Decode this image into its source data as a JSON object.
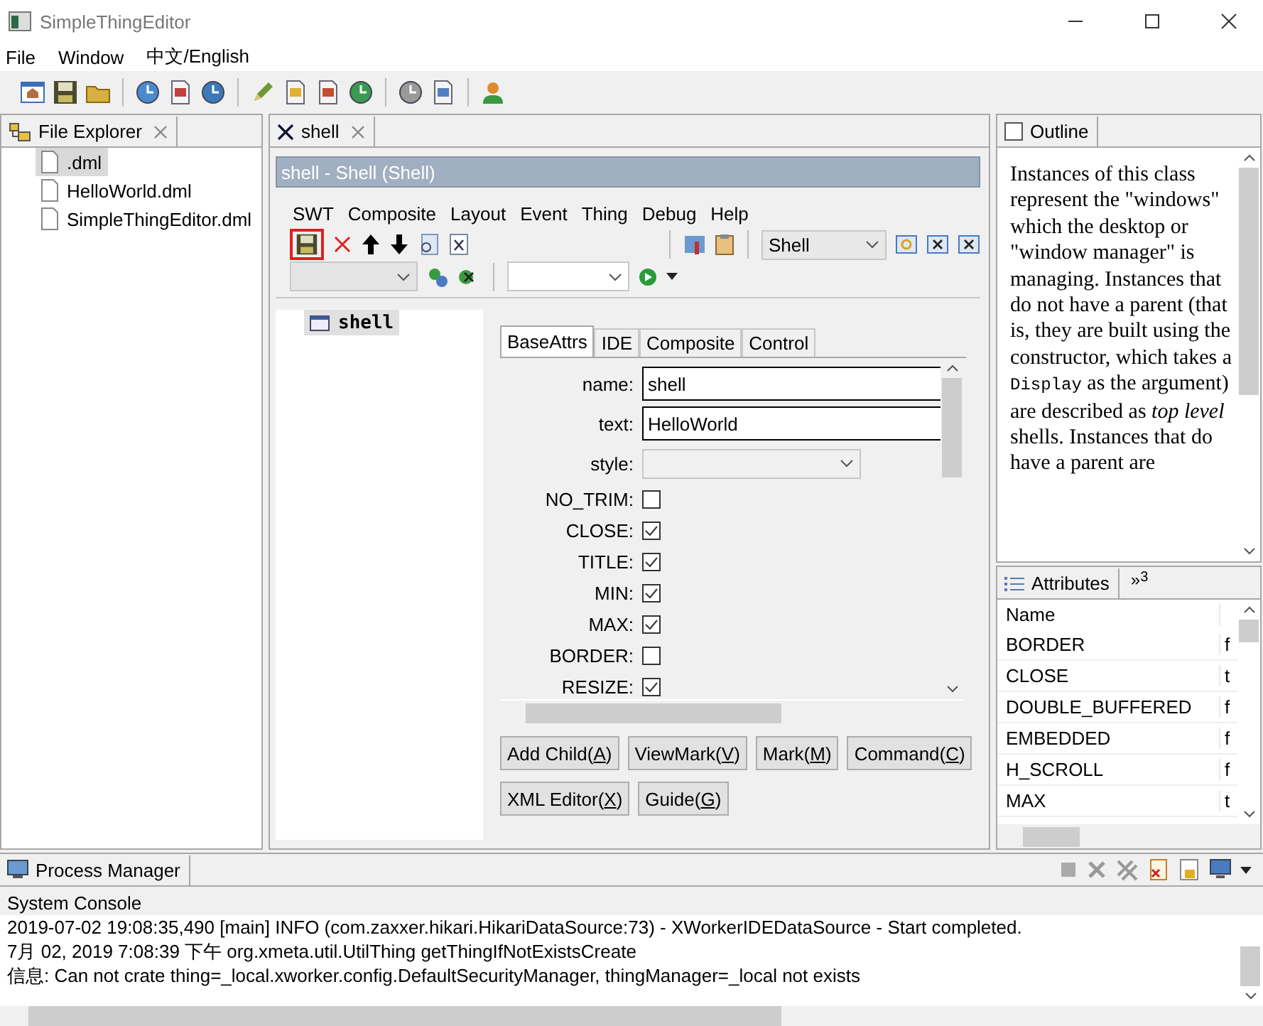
{
  "window": {
    "title": "SimpleThingEditor"
  },
  "menu": [
    "File",
    "Window",
    "中文/English"
  ],
  "file_explorer": {
    "tab": "File Explorer",
    "files": [
      {
        "name": ".dml",
        "selected": true
      },
      {
        "name": "HelloWorld.dml",
        "selected": false
      },
      {
        "name": "SimpleThingEditor.dml",
        "selected": false
      }
    ]
  },
  "editor": {
    "tab": "shell",
    "header": "shell - Shell  (Shell)",
    "menu": [
      "SWT",
      "Composite",
      "Layout",
      "Event",
      "Thing",
      "Debug",
      "Help"
    ],
    "save_focused": true,
    "type_select": "Shell",
    "tree": [
      {
        "label": "shell",
        "selected": true
      }
    ],
    "prop_tabs": [
      {
        "label": "BaseAttrs",
        "selected": true
      },
      {
        "label": "IDE",
        "selected": false
      },
      {
        "label": "Composite",
        "selected": false
      },
      {
        "label": "Control",
        "selected": false
      }
    ],
    "fields": [
      {
        "kind": "text",
        "label": "name:",
        "value": "shell"
      },
      {
        "kind": "text",
        "label": "text:",
        "value": "HelloWorld"
      },
      {
        "kind": "select",
        "label": "style:"
      },
      {
        "kind": "checkbox",
        "label": "NO_TRIM:",
        "checked": false
      },
      {
        "kind": "checkbox",
        "label": "CLOSE:",
        "checked": true
      },
      {
        "kind": "checkbox",
        "label": "TITLE:",
        "checked": true
      },
      {
        "kind": "checkbox",
        "label": "MIN:",
        "checked": true
      },
      {
        "kind": "checkbox",
        "label": "MAX:",
        "checked": true
      },
      {
        "kind": "checkbox",
        "label": "BORDER:",
        "checked": false
      },
      {
        "kind": "checkbox",
        "label": "RESIZE:",
        "checked": true
      }
    ],
    "button_rows": [
      [
        {
          "label": "Add Child(",
          "mnemonic": "A",
          "suffix": ")"
        },
        {
          "label": "ViewMark(",
          "mnemonic": "V",
          "suffix": ")"
        },
        {
          "label": "Mark(",
          "mnemonic": "M",
          "suffix": ")"
        },
        {
          "label": "Command(",
          "mnemonic": "C",
          "suffix": ")"
        }
      ],
      [
        {
          "label": "XML Editor(",
          "mnemonic": "X",
          "suffix": ")"
        },
        {
          "label": "Guide(",
          "mnemonic": "G",
          "suffix": ")"
        }
      ]
    ]
  },
  "outline": {
    "tab": "Outline",
    "segments": [
      {
        "kind": "plain",
        "text": "Instances of this class represent the \"windows\" which the desktop or \"window manager\" is managing. Instances that do not have a parent (that is, they are built using the constructor, which takes a "
      },
      {
        "kind": "code",
        "text": "Display"
      },
      {
        "kind": "plain",
        "text": " as the argument) are described as "
      },
      {
        "kind": "italic",
        "text": "top level"
      },
      {
        "kind": "plain",
        "text": " shells. Instances that do have a parent are"
      }
    ]
  },
  "attributes": {
    "tab": "Attributes",
    "overflow": "»",
    "overflow_count": "3",
    "columns": [
      "Name"
    ],
    "rows": [
      {
        "name": "BORDER",
        "value": "f"
      },
      {
        "name": "CLOSE",
        "value": "t"
      },
      {
        "name": "DOUBLE_BUFFERED",
        "value": "f"
      },
      {
        "name": "EMBEDDED",
        "value": "f"
      },
      {
        "name": "H_SCROLL",
        "value": "f"
      },
      {
        "name": "MAX",
        "value": "t"
      }
    ]
  },
  "process_manager": {
    "tab": "Process Manager",
    "console_title": "System Console",
    "lines": [
      "2019-07-02 19:08:35,490 [main]  INFO (com.zaxxer.hikari.HikariDataSource:73) - XWorkerIDEDataSource - Start completed.",
      "7月 02, 2019 7:08:39 下午 org.xmeta.util.UtilThing getThingIfNotExistsCreate",
      "信息: Can not crate thing=_local.xworker.config.DefaultSecurityManager, thingManager=_local not exists"
    ]
  }
}
